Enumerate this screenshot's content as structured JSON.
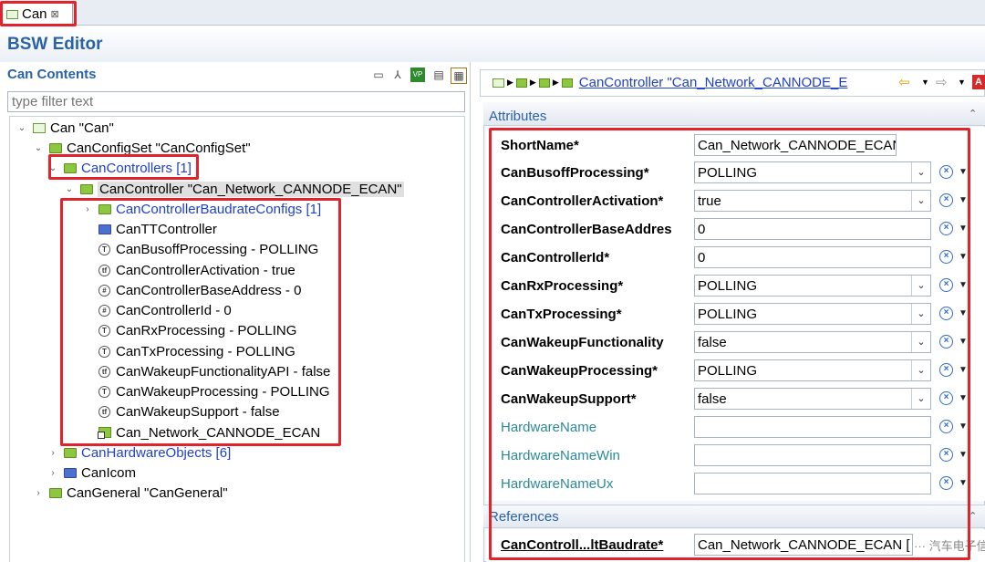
{
  "tab": {
    "label": "Can",
    "close": "⊠"
  },
  "editor_title": "BSW Editor",
  "left": {
    "title": "Can Contents",
    "filter_placeholder": "type filter text",
    "tree": [
      {
        "text": "Can \"Can\"",
        "twisty": "⌄",
        "icon": "module"
      },
      {
        "text": "CanConfigSet \"CanConfigSet\"",
        "twisty": "⌄",
        "icon": "folder"
      },
      {
        "text": "CanControllers [1]",
        "twisty": "⌄",
        "icon": "folder",
        "link": true
      },
      {
        "text": "CanController \"Can_Network_CANNODE_ECAN\"",
        "twisty": "⌄",
        "icon": "folder"
      },
      {
        "text": "CanControllerBaudrateConfigs [1]",
        "twisty": "›",
        "icon": "folder",
        "link": true
      },
      {
        "text": "CanTTController",
        "icon": "folder-blue"
      },
      {
        "text": "CanBusoffProcessing - POLLING",
        "icon": "param-t",
        "glyph": "T"
      },
      {
        "text": "CanControllerActivation - true",
        "icon": "param",
        "glyph": "tf"
      },
      {
        "text": "CanControllerBaseAddress - 0",
        "icon": "param",
        "glyph": "#"
      },
      {
        "text": "CanControllerId - 0",
        "icon": "param",
        "glyph": "#"
      },
      {
        "text": "CanRxProcessing - POLLING",
        "icon": "param-t",
        "glyph": "T"
      },
      {
        "text": "CanTxProcessing - POLLING",
        "icon": "param-t",
        "glyph": "T"
      },
      {
        "text": "CanWakeupFunctionalityAPI - false",
        "icon": "param",
        "glyph": "tf"
      },
      {
        "text": "CanWakeupProcessing - POLLING",
        "icon": "param-t",
        "glyph": "T"
      },
      {
        "text": "CanWakeupSupport - false",
        "icon": "param",
        "glyph": "tf"
      },
      {
        "text": "Can_Network_CANNODE_ECAN",
        "icon": "reference"
      },
      {
        "text": "CanHardwareObjects [6]",
        "twisty": "›",
        "icon": "folder",
        "link": true
      },
      {
        "text": "CanIcom",
        "twisty": "›",
        "icon": "folder-blue"
      },
      {
        "text": "CanGeneral \"CanGeneral\"",
        "twisty": "›",
        "icon": "folder"
      }
    ]
  },
  "right": {
    "breadcrumb_link": "CanController \"Can_Network_CANNODE_E",
    "attributes_title": "Attributes",
    "references_title": "References",
    "fields": [
      {
        "label": "ShortName*",
        "value": "Can_Network_CANNODE_ECAN",
        "type": "text",
        "required": true
      },
      {
        "label": "CanBusoffProcessing*",
        "value": "POLLING",
        "type": "combo",
        "required": true
      },
      {
        "label": "CanControllerActivation*",
        "value": "true",
        "type": "combo",
        "required": true
      },
      {
        "label": "CanControllerBaseAddres",
        "value": "0",
        "type": "text",
        "required": true
      },
      {
        "label": "CanControllerId*",
        "value": "0",
        "type": "text",
        "required": true
      },
      {
        "label": "CanRxProcessing*",
        "value": "POLLING",
        "type": "combo",
        "required": true
      },
      {
        "label": "CanTxProcessing*",
        "value": "POLLING",
        "type": "combo",
        "required": true
      },
      {
        "label": "CanWakeupFunctionality",
        "value": "false",
        "type": "combo",
        "required": true
      },
      {
        "label": "CanWakeupProcessing*",
        "value": "POLLING",
        "type": "combo",
        "required": true
      },
      {
        "label": "CanWakeupSupport*",
        "value": "false",
        "type": "combo",
        "required": true
      },
      {
        "label": "HardwareName",
        "value": "",
        "type": "text",
        "required": false
      },
      {
        "label": "HardwareNameWin",
        "value": "",
        "type": "text",
        "required": false
      },
      {
        "label": "HardwareNameUx",
        "value": "",
        "type": "text",
        "required": false
      }
    ],
    "reference": {
      "label": "CanControll...ltBaudrate*",
      "value": "Can_Network_CANNODE_ECAN [",
      "extra": "··· 汽车电子信号"
    }
  },
  "colors": {
    "accent": "#2a62a8",
    "link": "#1d3fd2",
    "highlight_box": "#e3232b",
    "optional_label": "#2a8a9a"
  }
}
